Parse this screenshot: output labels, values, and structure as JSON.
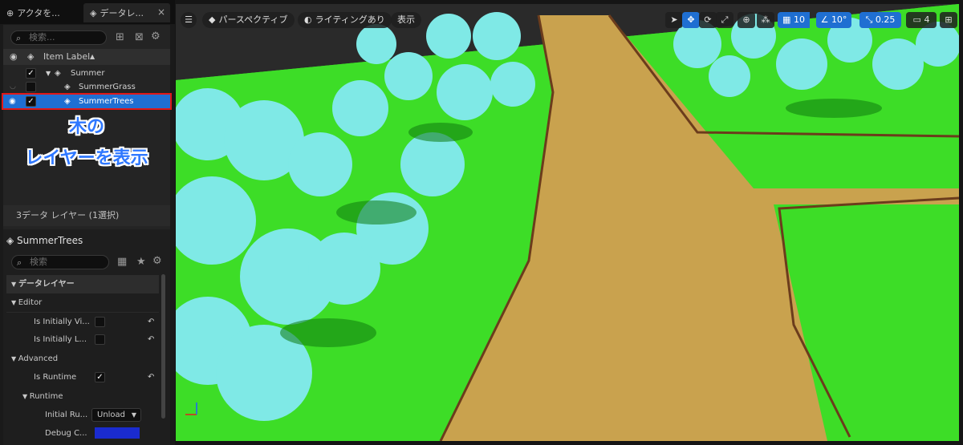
{
  "tabs": [
    {
      "label": "アクタを...",
      "icon": "actor-icon"
    },
    {
      "label": "データレ...",
      "icon": "layers-icon",
      "close": "×"
    }
  ],
  "outliner": {
    "search_placeholder": "検索...",
    "header_label": "Item Label",
    "sort_indicator": "▲",
    "rows": [
      {
        "label": "Summer",
        "checked": "✓"
      },
      {
        "label": "SummerGrass",
        "checked": ""
      },
      {
        "label": "SummerTrees",
        "checked": "✓"
      }
    ],
    "status": "3データ レイヤー (1選択)"
  },
  "annotation": {
    "line1": "木の",
    "line2": "レイヤーを表示",
    "color": "#2f78ff"
  },
  "details": {
    "title": "SummerTrees",
    "search_placeholder": "検索",
    "categories": {
      "data_layer": "データレイヤー",
      "editor": "Editor",
      "advanced": "Advanced",
      "runtime": "Runtime"
    },
    "props": {
      "initially_visible": "Is Initially Vi...",
      "initially_loaded": "Is Initially L...",
      "is_runtime": "Is Runtime",
      "is_runtime_checked": "✓",
      "initial_runtime": "Initial Ru...",
      "initial_runtime_value": "Unload",
      "debug_color": "Debug C..."
    }
  },
  "viewport": {
    "menu_icon": "hamburger-icon",
    "perspective_label": "パースペクティブ",
    "lighting_label": "ライティングあり",
    "show_label": "表示",
    "grid_snap_value": "10",
    "rotation_snap_value": "10°",
    "scale_snap_value": "0.25",
    "camera_speed_value": "4",
    "colors": {
      "grass": "#3ddd27",
      "path": "#c9a24e",
      "trees": "#7fe9e6",
      "selected": "#1f6fd2"
    }
  }
}
